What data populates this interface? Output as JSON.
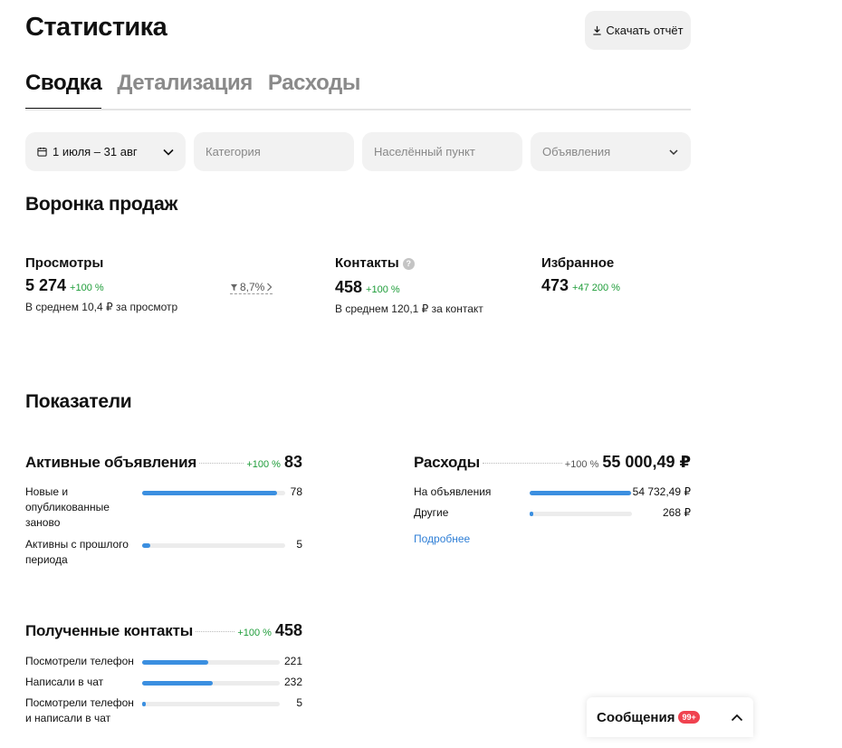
{
  "header": {
    "title": "Статистика",
    "download_label": "Скачать отчёт"
  },
  "tabs": [
    {
      "label": "Сводка",
      "active": true
    },
    {
      "label": "Детализация",
      "active": false
    },
    {
      "label": "Расходы",
      "active": false
    }
  ],
  "filters": {
    "dates": "1 июля – 31 авг",
    "category_placeholder": "Категория",
    "locality_placeholder": "Населённый пункт",
    "ads_selected": "Объявления"
  },
  "funnel": {
    "title": "Воронка продаж",
    "views": {
      "label": "Просмотры",
      "value": "5 274",
      "delta": "+100 %",
      "sub": "В среднем 10,4 ₽ за просмотр"
    },
    "conversion": "8,7%",
    "contacts": {
      "label": "Контакты",
      "value": "458",
      "delta": "+100 %",
      "sub": "В среднем 120,1 ₽ за контакт"
    },
    "favorites": {
      "label": "Избранное",
      "value": "473",
      "delta": "+47 200 %"
    }
  },
  "indicators": {
    "title": "Показатели",
    "active_ads": {
      "title": "Активные объявления",
      "delta": "+100 %",
      "total": "83",
      "rows": [
        {
          "label": "Новые и опубликованные заново",
          "value": "78",
          "fill": 0.94
        },
        {
          "label": "Активны с прошлого периода",
          "value": "5",
          "fill": 0.06
        }
      ]
    },
    "expenses": {
      "title": "Расходы",
      "delta": "+100 %",
      "total": "55 000,49 ₽",
      "rows": [
        {
          "label": "На объявления",
          "value": "54 732,49 ₽",
          "fill": 0.99
        },
        {
          "label": "Другие",
          "value": "268 ₽",
          "fill": 0.01
        }
      ],
      "more_label": "Подробнее"
    },
    "contacts": {
      "title": "Полученные контакты",
      "delta": "+100 %",
      "total": "458",
      "rows": [
        {
          "label": "Посмотрели телефон",
          "value": "221",
          "fill": 0.48
        },
        {
          "label": "Написали в чат",
          "value": "232",
          "fill": 0.51
        },
        {
          "label": "Посмотрели телефон и написали в чат",
          "value": "5",
          "fill": 0.02
        }
      ]
    }
  },
  "messages": {
    "label": "Сообщения",
    "badge": "99+"
  },
  "colors": {
    "accent": "#3b8fe0",
    "positive": "#1f9d3a",
    "badge": "#f0424f",
    "link": "#2f7fd6"
  }
}
